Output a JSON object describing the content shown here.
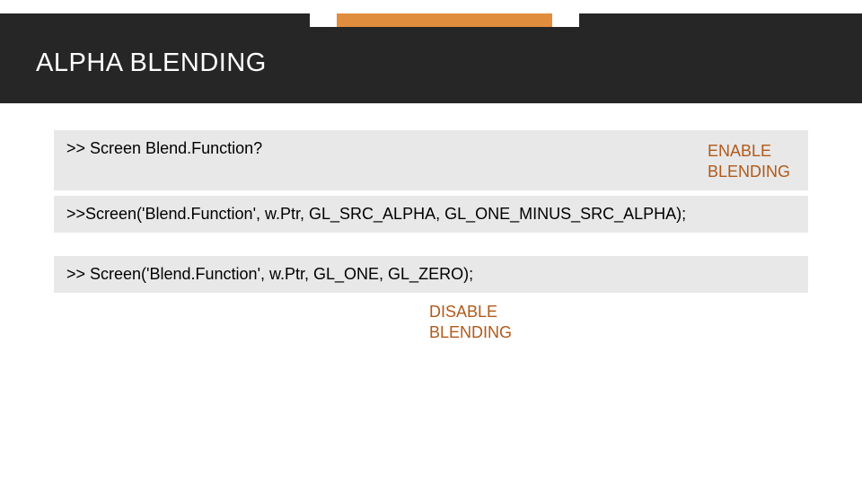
{
  "title": "ALPHA BLENDING",
  "code": {
    "line1": ">> Screen Blend.Function?",
    "line2": ">>Screen('Blend.Function', w.Ptr, GL_SRC_ALPHA, GL_ONE_MINUS_SRC_ALPHA);",
    "line3": ">> Screen('Blend.Function', w.Ptr, GL_ONE, GL_ZERO);"
  },
  "labels": {
    "enable1": "ENABLE",
    "enable2": "BLENDING",
    "disable1": "DISABLE",
    "disable2": "BLENDING"
  }
}
